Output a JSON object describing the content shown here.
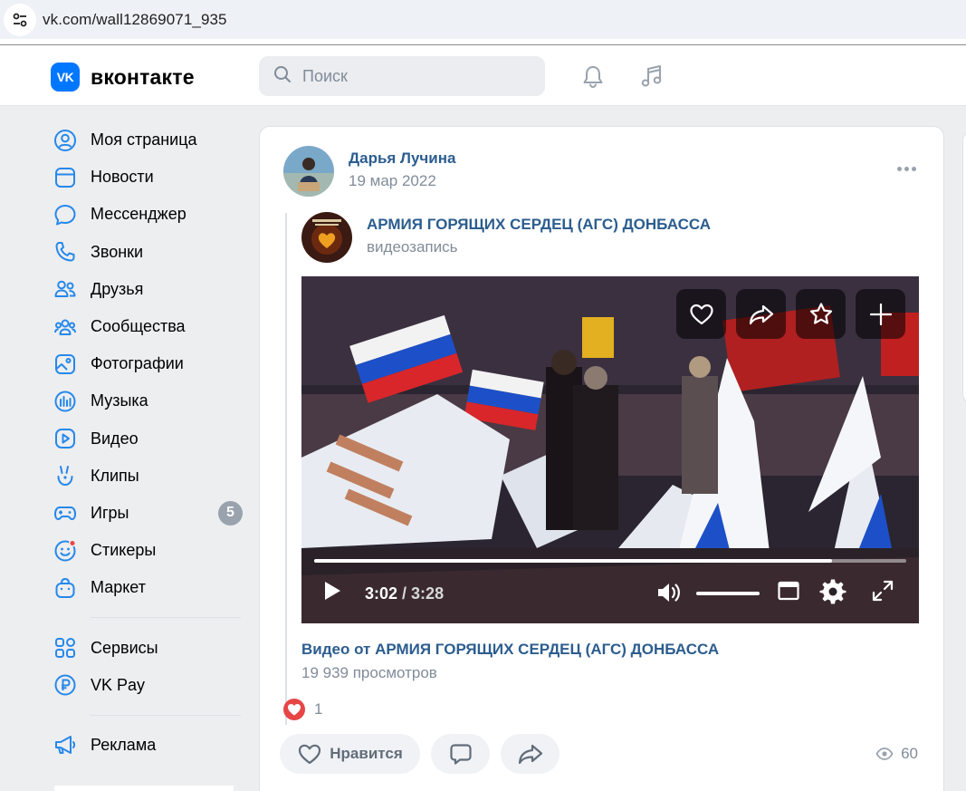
{
  "browser": {
    "url": "vk.com/wall12869071_935",
    "site_info_icon": "tune-icon"
  },
  "header": {
    "logo_mark": "VK",
    "logo_text": "вконтакте",
    "search_placeholder": "Поиск",
    "icons": [
      "bell-icon",
      "music-note-icon"
    ]
  },
  "sidebar": {
    "items": [
      {
        "label": "Моя страница",
        "icon": "user-circle-icon"
      },
      {
        "label": "Новости",
        "icon": "newsfeed-icon"
      },
      {
        "label": "Мессенджер",
        "icon": "message-icon"
      },
      {
        "label": "Звонки",
        "icon": "phone-icon"
      },
      {
        "label": "Друзья",
        "icon": "friends-icon"
      },
      {
        "label": "Сообщества",
        "icon": "communities-icon"
      },
      {
        "label": "Фотографии",
        "icon": "photo-icon"
      },
      {
        "label": "Музыка",
        "icon": "music-stats-icon"
      },
      {
        "label": "Видео",
        "icon": "video-icon"
      },
      {
        "label": "Клипы",
        "icon": "clips-icon"
      },
      {
        "label": "Игры",
        "icon": "gamepad-icon",
        "badge": "5"
      },
      {
        "label": "Стикеры",
        "icon": "smile-icon",
        "dot": true
      },
      {
        "label": "Маркет",
        "icon": "bag-icon"
      }
    ],
    "items2": [
      {
        "label": "Сервисы",
        "icon": "services-icon"
      },
      {
        "label": "VK Pay",
        "icon": "ruble-icon"
      }
    ],
    "items3": [
      {
        "label": "Реклама",
        "icon": "megaphone-icon"
      }
    ]
  },
  "post": {
    "author": "Дарья Лучина",
    "date": "19 мар 2022",
    "repost": {
      "group_name": "АРМИЯ ГОРЯЩИХ СЕРДЕЦ (АГС) ДОНБАССА",
      "type": "видеозапись"
    },
    "video": {
      "current_time": "3:02",
      "separator": " / ",
      "duration": "3:28",
      "progress": 0.875,
      "volume": 1.0,
      "title": "Видео от АРМИЯ ГОРЯЩИХ СЕРДЕЦ (АГС) ДОНБАССА",
      "views": "19 939 просмотров"
    },
    "reaction_count": "1",
    "like_label": "Нравится",
    "views": "60"
  },
  "colors": {
    "brand": "#0077ff",
    "link": "#2c5d8f",
    "muted": "#818c99",
    "like_red": "#e64646"
  }
}
